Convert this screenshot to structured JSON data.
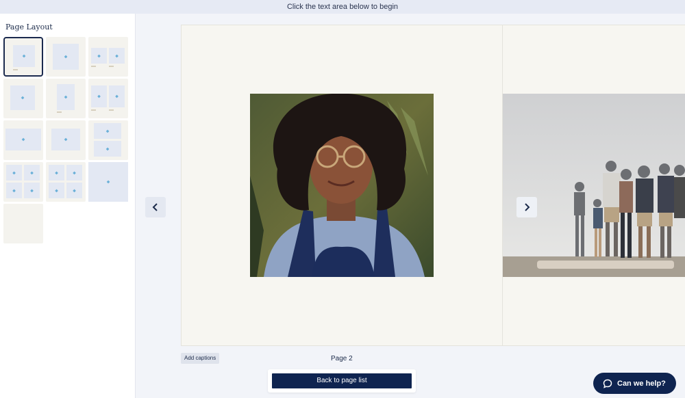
{
  "banner": {
    "text": "Click the text area below to begin"
  },
  "sidebar": {
    "title": "Page Layout",
    "layouts": [
      "single-photo-small-caption",
      "single-photo-centered",
      "two-photos-side-by-side",
      "single-photo-small",
      "single-photo-portrait",
      "two-photos-portraits",
      "single-photo-wide",
      "single-photo-wide-inset",
      "two-photos-stacked",
      "four-photos-grid",
      "four-photos-grid-inset",
      "single-photo-full-bleed",
      "blank-page"
    ],
    "selected_index": 0
  },
  "book": {
    "left_photo_desc": "portrait-photo",
    "right_photo_desc": "family-photo"
  },
  "controls": {
    "add_captions": "Add captions",
    "page_label": "Page 2",
    "back_button": "Back to page list",
    "prev_icon": "chevron-left-icon",
    "next_icon": "chevron-right-icon"
  },
  "help": {
    "label": "Can we help?",
    "icon": "chat-bubble-icon"
  },
  "colors": {
    "navy": "#0f2450",
    "slot": "#e3e8f3",
    "page": "#f7f6f1"
  }
}
